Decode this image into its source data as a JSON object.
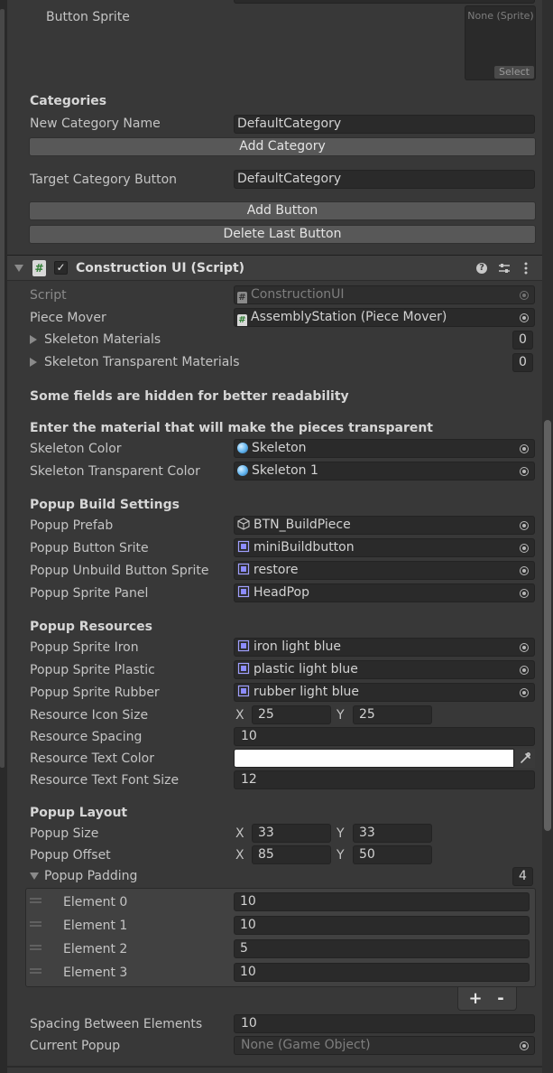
{
  "top": {
    "button_sprite_label": "Button Sprite",
    "sprite_none": "None (Sprite)",
    "sprite_select": "Select"
  },
  "categories": {
    "header": "Categories",
    "new_category_name_label": "New Category Name",
    "new_category_name_value": "DefaultCategory",
    "add_category_button": "Add Category",
    "target_category_button_label": "Target Category Button",
    "target_category_button_value": "DefaultCategory",
    "add_button": "Add Button",
    "delete_last_button": "Delete Last Button"
  },
  "component": {
    "title": "Construction UI (Script)",
    "script_label": "Script",
    "script_value": "ConstructionUI",
    "piece_mover_label": "Piece Mover",
    "piece_mover_value": "AssemblyStation (Piece Mover)",
    "skeleton_materials_label": "Skeleton Materials",
    "skeleton_materials_count": "0",
    "skeleton_transparent_materials_label": "Skeleton Transparent Materials",
    "skeleton_transparent_materials_count": "0",
    "hidden_fields_note": "Some fields are hidden for better readability",
    "transparent_material_header": "Enter the material that will make the pieces transparent",
    "skeleton_color_label": "Skeleton Color",
    "skeleton_color_value": "Skeleton",
    "skeleton_transparent_color_label": "Skeleton Transparent Color",
    "skeleton_transparent_color_value": "Skeleton 1"
  },
  "popup_build": {
    "header": "Popup Build Settings",
    "prefab_label": "Popup Prefab",
    "prefab_value": "BTN_BuildPiece",
    "button_srite_label": "Popup Button Srite",
    "button_srite_value": "miniBuildbutton",
    "unbuild_label": "Popup Unbuild Button Sprite",
    "unbuild_value": "restore",
    "panel_label": "Popup Sprite Panel",
    "panel_value": "HeadPop"
  },
  "popup_resources": {
    "header": "Popup Resources",
    "iron_label": "Popup Sprite Iron",
    "iron_value": "iron light blue",
    "plastic_label": "Popup Sprite Plastic",
    "plastic_value": "plastic light blue",
    "rubber_label": "Popup Sprite Rubber",
    "rubber_value": "rubber light blue",
    "icon_size_label": "Resource Icon Size",
    "icon_size_x_label": "X",
    "icon_size_x": "25",
    "icon_size_y_label": "Y",
    "icon_size_y": "25",
    "spacing_label": "Resource Spacing",
    "spacing_value": "10",
    "text_color_label": "Resource Text Color",
    "text_color_hex": "#ffffff",
    "font_size_label": "Resource Text Font Size",
    "font_size_value": "12"
  },
  "popup_layout": {
    "header": "Popup Layout",
    "size_label": "Popup Size",
    "size_x_label": "X",
    "size_x": "33",
    "size_y_label": "Y",
    "size_y": "33",
    "offset_label": "Popup Offset",
    "offset_x_label": "X",
    "offset_x": "85",
    "offset_y_label": "Y",
    "offset_y": "50",
    "padding_label": "Popup Padding",
    "padding_count": "4",
    "padding_elements": [
      {
        "label": "Element 0",
        "value": "10"
      },
      {
        "label": "Element 1",
        "value": "10"
      },
      {
        "label": "Element 2",
        "value": "5"
      },
      {
        "label": "Element 3",
        "value": "10"
      }
    ],
    "add_label": "+",
    "remove_label": "-",
    "spacing_between_label": "Spacing Between Elements",
    "spacing_between_value": "10",
    "current_popup_label": "Current Popup",
    "current_popup_value": "None (Game Object)"
  },
  "colors": {
    "background": "#383838",
    "header_bar": "#3e3e3e",
    "accent_material": "#5fb3ef",
    "sprite_icon": "#8c8cff"
  }
}
